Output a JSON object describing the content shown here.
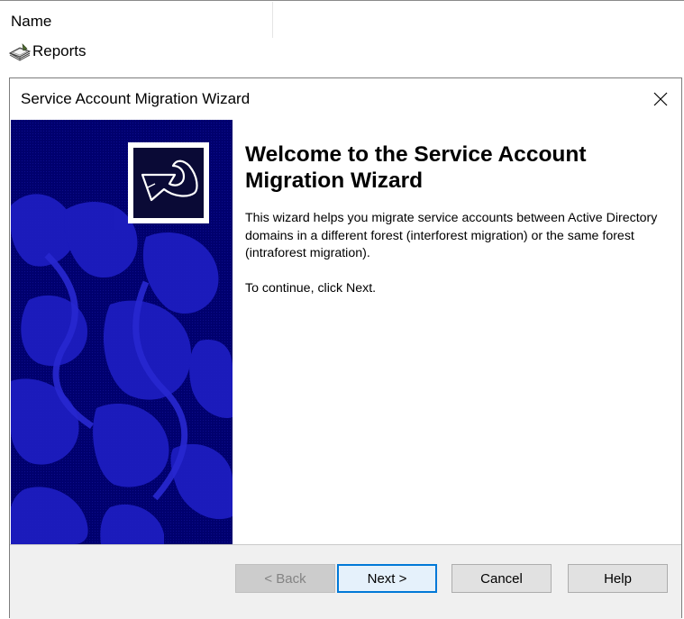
{
  "explorer": {
    "column_header": "Name",
    "rows": [
      {
        "label": "Reports",
        "icon": "reports-book-icon"
      }
    ]
  },
  "dialog": {
    "title": "Service Account Migration Wizard",
    "close_icon": "close-icon",
    "banner_icon": "wizard-arrow-icon",
    "heading": "Welcome to the Service Account Migration Wizard",
    "description": "This wizard helps you migrate service accounts between Active Directory domains in a different forest (interforest migration) or the same forest (intraforest migration).",
    "instruction": "To continue, click Next.",
    "buttons": {
      "back": "< Back",
      "next": "Next >",
      "cancel": "Cancel",
      "help": "Help"
    }
  },
  "colors": {
    "banner_background": "#00006e",
    "banner_pattern": "#1d1dc0",
    "default_button_border": "#0078d7"
  }
}
